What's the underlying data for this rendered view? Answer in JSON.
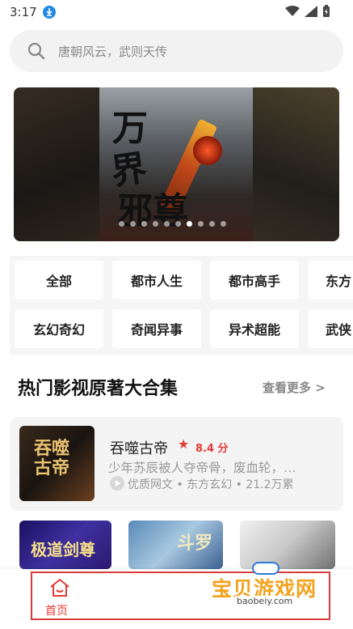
{
  "status_bar": {
    "time": "3:17"
  },
  "search": {
    "placeholder": "唐朝风云，武则天传"
  },
  "banner": {
    "cover_title_line1": "万",
    "cover_title_line2": "界",
    "cover_title_line3": "邪尊",
    "dots_count": 10,
    "active_dot_index": 6
  },
  "categories": {
    "row1": [
      "全部",
      "都市人生",
      "都市高手",
      "东方"
    ],
    "row2": [
      "玄幻奇幻",
      "奇闻异事",
      "异术超能",
      "武侠"
    ]
  },
  "section": {
    "title": "热门影视原著大合集",
    "more": "查看更多 >"
  },
  "book": {
    "cover_text": "吞噬古帝",
    "title": "吞噬古帝",
    "star": "★",
    "score": "8.4 分",
    "desc": "少年苏辰被人夺帝骨，废血轮，…",
    "meta": "优质网文 • 东方玄幻 • 21.2万累"
  },
  "thumbs": [
    {
      "text": "极道剑尊"
    },
    {
      "text": "斗罗"
    },
    {
      "text": ""
    }
  ],
  "bottom_nav": {
    "home_label": "首页"
  },
  "watermark": {
    "brand": "宝贝游戏网",
    "url": "baobeiy.com"
  },
  "colors": {
    "accent": "#e53935",
    "watermark": "#f3a21c"
  }
}
